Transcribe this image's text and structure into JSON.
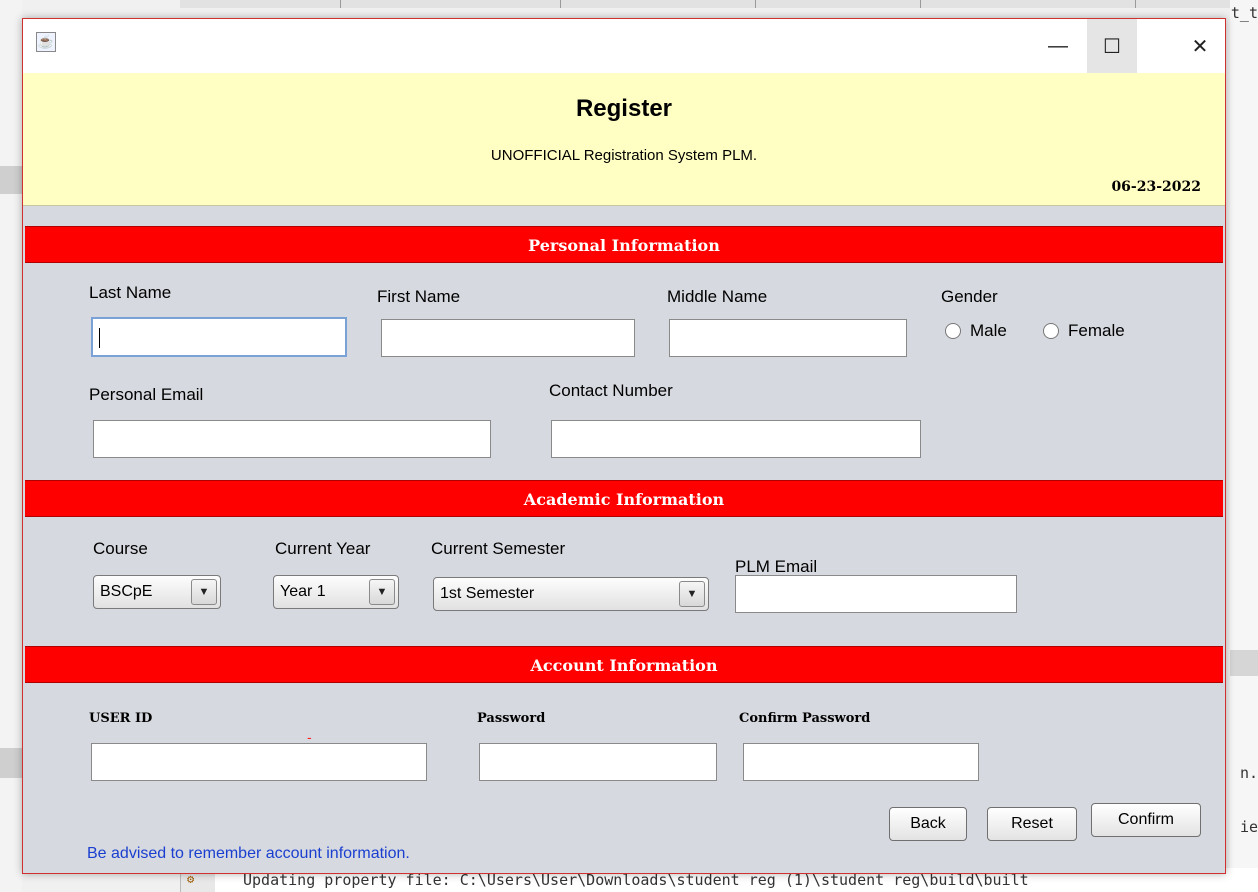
{
  "ide": {
    "console_line": "Updating property file: C:\\Users\\User\\Downloads\\student reg (1)\\student reg\\build\\built",
    "right_fragments": [
      "t_t",
      "n.",
      "ie"
    ]
  },
  "window": {
    "controls": {
      "minimize": "—",
      "maximize": "☐",
      "close": "✕"
    },
    "header": {
      "title": "Register",
      "subtitle": "UNOFFICIAL Registration System PLM.",
      "date": "06-23-2022"
    },
    "sections": {
      "personal": "Personal Information",
      "academic": "Academic Information",
      "account": "Account Information"
    },
    "personal": {
      "last_name_label": "Last Name",
      "last_name_value": "",
      "first_name_label": "First Name",
      "first_name_value": "",
      "middle_name_label": "Middle Name",
      "middle_name_value": "",
      "gender_label": "Gender",
      "gender_options": [
        "Male",
        "Female"
      ],
      "email_label": "Personal Email",
      "email_value": "",
      "contact_label": "Contact Number",
      "contact_value": ""
    },
    "academic": {
      "course_label": "Course",
      "course_value": "BSCpE",
      "year_label": "Current Year",
      "year_value": "Year 1",
      "semester_label": "Current Semester",
      "semester_value": "1st Semester",
      "plm_email_label": "PLM Email",
      "plm_email_value": ""
    },
    "account": {
      "user_id_label": "USER ID",
      "user_id_indicator": "-",
      "user_id_value": "",
      "password_label": "Password",
      "password_value": "",
      "confirm_label": "Confirm Password",
      "confirm_value": ""
    },
    "buttons": {
      "back": "Back",
      "reset": "Reset",
      "confirm": "Confirm"
    },
    "advice": "Be advised to remember account information."
  }
}
